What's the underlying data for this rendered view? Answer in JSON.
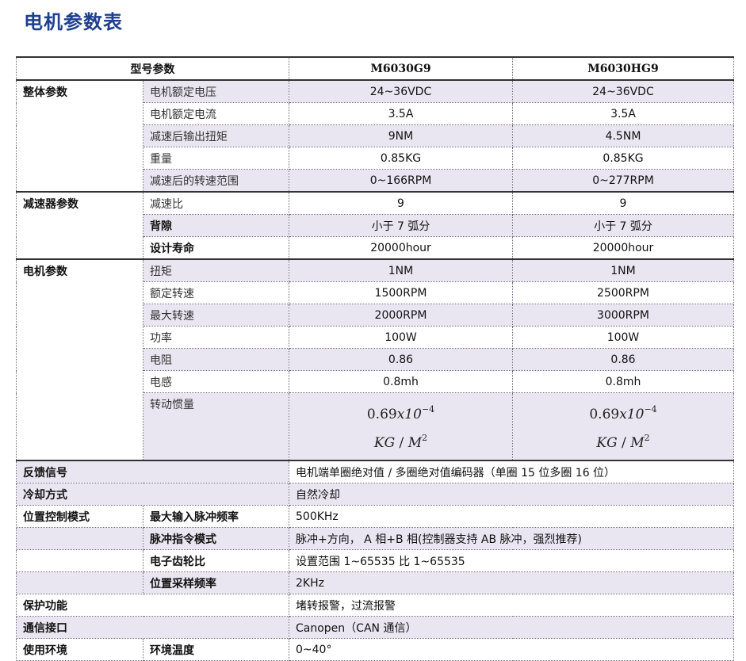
{
  "title": "电机参数表",
  "header": {
    "model_param": "型号参数",
    "model_a": "M6030G9",
    "model_b": "M6030HG9"
  },
  "overall": {
    "category": "整体参数",
    "rows": [
      {
        "param": "电机额定电压",
        "a": "24~36VDC",
        "b": "24~36VDC"
      },
      {
        "param": "电机额定电流",
        "a": "3.5A",
        "b": "3.5A"
      },
      {
        "param": "减速后输出扭矩",
        "a": "9NM",
        "b": "4.5NM"
      },
      {
        "param": "重量",
        "a": "0.85KG",
        "b": "0.85KG"
      },
      {
        "param": "减速后的转速范围",
        "a": "0~166RPM",
        "b": "0~277RPM"
      }
    ]
  },
  "reducer": {
    "category": "减速器参数",
    "rows": [
      {
        "param": "减速比",
        "a": "9",
        "b": "9"
      },
      {
        "param": "背隙",
        "a": "小于 7 弧分",
        "b": "小于 7 弧分"
      },
      {
        "param": "设计寿命",
        "a": "20000hour",
        "b": "20000hour"
      }
    ]
  },
  "motor": {
    "category": "电机参数",
    "rows": [
      {
        "param": "扭矩",
        "a": "1NM",
        "b": "1NM"
      },
      {
        "param": "额定转速",
        "a": "1500RPM",
        "b": "2500RPM"
      },
      {
        "param": "最大转速",
        "a": "2000RPM",
        "b": "3000RPM"
      },
      {
        "param": "功率",
        "a": "100W",
        "b": "100W"
      },
      {
        "param": "电阻",
        "a": "0.86",
        "b": "0.86"
      },
      {
        "param": "电感",
        "a": "0.8mh",
        "b": "0.8mh"
      }
    ],
    "inertia": {
      "param": "转动惯量",
      "base": "0.69",
      "times": "x10",
      "exp": "−4",
      "unit_kg": "KG",
      "slash": " / ",
      "unit_m": "M",
      "exp2": "2"
    }
  },
  "feedback": {
    "label": "反馈信号",
    "value": "电机端单圈绝对值 / 多圈绝对值编码器（单圈 15 位多圈 16 位）"
  },
  "cooling": {
    "label": "冷却方式",
    "value": "自然冷却"
  },
  "position": {
    "label": "位置控制模式",
    "rows": [
      {
        "sub": "最大输入脉冲频率",
        "value": "500KHz"
      },
      {
        "sub": "脉冲指令模式",
        "value": "脉冲+方向， A 相+B 相(控制器支持 AB 脉冲，强烈推荐)"
      },
      {
        "sub": "电子齿轮比",
        "value": "设置范围 1~65535 比 1~65535"
      },
      {
        "sub": "位置采样频率",
        "value": "2KHz"
      }
    ]
  },
  "protection": {
    "label": "保护功能",
    "value": "堵转报警，过流报警"
  },
  "comm": {
    "label": "通信接口",
    "value": "Canopen（CAN 通信）"
  },
  "environment": {
    "label": "使用环境",
    "sub": "环境温度",
    "value": "0~40°"
  }
}
